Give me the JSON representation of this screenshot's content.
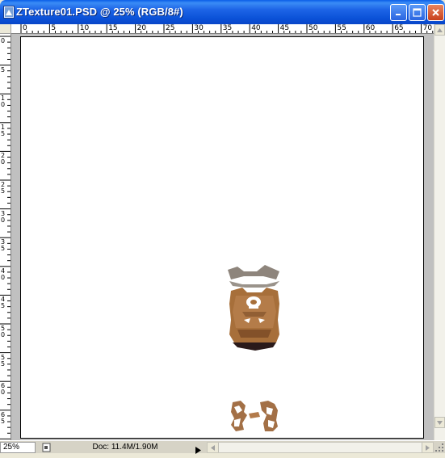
{
  "window": {
    "title": "ZTexture01.PSD @ 25% (RGB/8#)",
    "icons": {
      "app": "photoshop-document-icon",
      "minimize": "minimize-icon",
      "maximize": "maximize-icon",
      "close": "close-icon"
    },
    "colors": {
      "titlebar": "#0b52d8",
      "close_button": "#c8401c"
    }
  },
  "rulers": {
    "horizontal_labels": [
      "0",
      "5",
      "10",
      "15",
      "20",
      "25",
      "30",
      "35",
      "40",
      "45",
      "50",
      "55",
      "60",
      "65",
      "70"
    ],
    "vertical_labels": [
      "0",
      "5",
      "10",
      "15",
      "20",
      "25",
      "30",
      "35",
      "40",
      "45",
      "50",
      "55",
      "60",
      "65"
    ]
  },
  "canvas": {
    "background": "#ffffff",
    "content": [
      "uv-face-texture-island",
      "uv-hand-texture-islands"
    ]
  },
  "status": {
    "zoom": "25%",
    "doc_info": "Doc: 11.4M/1.90M"
  }
}
